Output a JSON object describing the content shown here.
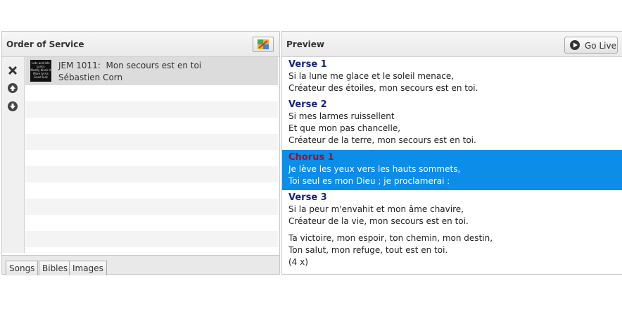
{
  "order_panel": {
    "title": "Order of Service",
    "item": {
      "thumbnail_text": "Lots and lots Lyrics Mostly blank it More lyrics Good luck",
      "title": "JEM 1011:  Mon secours est en toi",
      "author": "Sébastien Corn"
    },
    "tabs": [
      "Songs",
      "Bibles",
      "Images"
    ]
  },
  "preview_panel": {
    "title": "Preview",
    "go_live_label": "Go Live",
    "verses": [
      {
        "label": "Verse 1",
        "lines": [
          "Si la lune me glace et le soleil menace,",
          "Créateur des étoiles, mon secours est en toi."
        ]
      },
      {
        "label": "Verse 2",
        "lines": [
          "Si mes larmes ruissellent",
          "Et que mon pas chancelle,",
          "Créateur de la terre, mon secours est en toi."
        ]
      },
      {
        "label": "Chorus 1",
        "lines": [
          "Je lève les yeux vers les hauts sommets,",
          "Toi seul es mon Dieu ; je proclamerai :"
        ]
      },
      {
        "label": "Verse 3",
        "lines": [
          "Si la peur m'envahit et mon âme chavire,",
          "Créateur de la vie, mon secours est en toi."
        ]
      },
      {
        "label": "",
        "lines": [
          "Ta victoire, mon espoir, ton chemin, mon destin,",
          "Ton salut, mon refuge, tout est en toi.",
          "(4 x)"
        ]
      }
    ],
    "selected_verse": "Chorus 1"
  },
  "colors": {
    "selection": "#0c8de8",
    "verse_label": "#1a237e",
    "selected_label": "#9b1030"
  }
}
